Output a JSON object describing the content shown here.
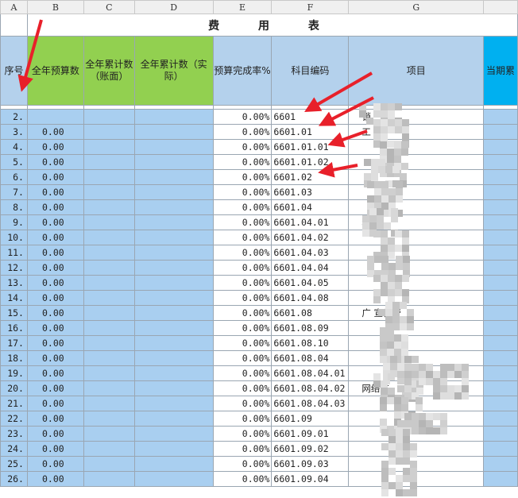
{
  "columns": [
    "A",
    "B",
    "C",
    "D",
    "E",
    "F",
    "G",
    ""
  ],
  "title": "费 用 表",
  "headers": {
    "seq": "序号",
    "annual_budget": "全年预算数",
    "annual_cum_book": "全年累计数（账面）",
    "annual_cum_actual": "全年累计数（实际）",
    "budget_rate": "预算完成率%",
    "account_code": "科目编码",
    "item": "项目",
    "current_period": "当期累"
  },
  "rows": [
    {
      "seq": "2.",
      "budget": "",
      "rate": "0.00%",
      "code": "6601",
      "item": "销"
    },
    {
      "seq": "3.",
      "budget": "0.00",
      "rate": "0.00%",
      "code": "6601.01",
      "item": "工"
    },
    {
      "seq": "4.",
      "budget": "0.00",
      "rate": "0.00%",
      "code": "6601.01.01",
      "item": ""
    },
    {
      "seq": "5.",
      "budget": "0.00",
      "rate": "0.00%",
      "code": "6601.01.02",
      "item": ""
    },
    {
      "seq": "6.",
      "budget": "0.00",
      "rate": "0.00%",
      "code": "6601.02",
      "item": ""
    },
    {
      "seq": "7.",
      "budget": "0.00",
      "rate": "0.00%",
      "code": "6601.03",
      "item": ""
    },
    {
      "seq": "8.",
      "budget": "0.00",
      "rate": "0.00%",
      "code": "6601.04",
      "item": ""
    },
    {
      "seq": "9.",
      "budget": "0.00",
      "rate": "0.00%",
      "code": "6601.04.01",
      "item": "利费"
    },
    {
      "seq": "10.",
      "budget": "0.00",
      "rate": "0.00%",
      "code": "6601.04.02",
      "item": ""
    },
    {
      "seq": "11.",
      "budget": "0.00",
      "rate": "0.00%",
      "code": "6601.04.03",
      "item": ""
    },
    {
      "seq": "12.",
      "budget": "0.00",
      "rate": "0.00%",
      "code": "6601.04.04",
      "item": ""
    },
    {
      "seq": "13.",
      "budget": "0.00",
      "rate": "0.00%",
      "code": "6601.04.05",
      "item": ""
    },
    {
      "seq": "14.",
      "budget": "0.00",
      "rate": "0.00%",
      "code": "6601.04.08",
      "item": ""
    },
    {
      "seq": "15.",
      "budget": "0.00",
      "rate": "0.00%",
      "code": "6601.08",
      "item": "广 宣传费"
    },
    {
      "seq": "16.",
      "budget": "0.00",
      "rate": "0.00%",
      "code": "6601.08.09",
      "item": ""
    },
    {
      "seq": "17.",
      "budget": "0.00",
      "rate": "0.00%",
      "code": "6601.08.10",
      "item": ""
    },
    {
      "seq": "18.",
      "budget": "0.00",
      "rate": "0.00%",
      "code": "6601.08.04",
      "item": ""
    },
    {
      "seq": "19.",
      "budget": "0.00",
      "rate": "0.00%",
      "code": "6601.08.04.01",
      "item": ""
    },
    {
      "seq": "20.",
      "budget": "0.00",
      "rate": "0.00%",
      "code": "6601.08.04.02",
      "item": "网络广"
    },
    {
      "seq": "21.",
      "budget": "0.00",
      "rate": "0.00%",
      "code": "6601.08.04.03",
      "item": ""
    },
    {
      "seq": "22.",
      "budget": "0.00",
      "rate": "0.00%",
      "code": "6601.09",
      "item": ""
    },
    {
      "seq": "23.",
      "budget": "0.00",
      "rate": "0.00%",
      "code": "6601.09.01",
      "item": ""
    },
    {
      "seq": "24.",
      "budget": "0.00",
      "rate": "0.00%",
      "code": "6601.09.02",
      "item": ""
    },
    {
      "seq": "25.",
      "budget": "0.00",
      "rate": "0.00%",
      "code": "6601.09.03",
      "item": ""
    },
    {
      "seq": "26.",
      "budget": "0.00",
      "rate": "0.00%",
      "code": "6601.09.04",
      "item": ""
    }
  ],
  "colors": {
    "header_blue": "#b4d1ec",
    "header_green": "#92d050",
    "row_blue": "#a9cff0",
    "current_col_cyan": "#00b0f0",
    "annotation_red": "#e8202a"
  }
}
